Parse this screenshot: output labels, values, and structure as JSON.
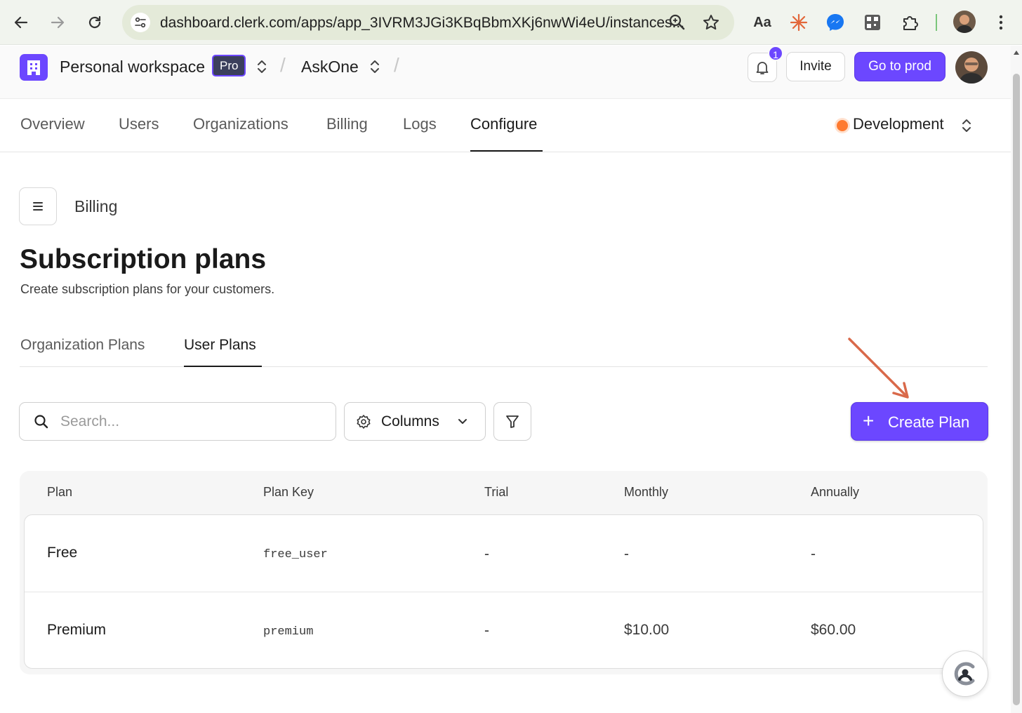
{
  "browser": {
    "url": "dashboard.clerk.com/apps/app_3IVRM3JGi3KBqBbmXKj6nwWi4eU/instances...",
    "ext_aa_label": "Aa"
  },
  "header": {
    "workspace_name": "Personal workspace",
    "plan_badge": "Pro",
    "separator": "/",
    "app_name": "AskOne",
    "notification_count": "1",
    "invite_label": "Invite",
    "go_prod_label": "Go to prod"
  },
  "nav": {
    "items": [
      {
        "label": "Overview"
      },
      {
        "label": "Users"
      },
      {
        "label": "Organizations"
      },
      {
        "label": "Billing"
      },
      {
        "label": "Logs"
      },
      {
        "label": "Configure"
      }
    ],
    "active": "Configure",
    "environment": "Development"
  },
  "main": {
    "section": "Billing",
    "title": "Subscription plans",
    "subtitle": "Create subscription plans for your customers.",
    "tabs": [
      {
        "label": "Organization Plans"
      },
      {
        "label": "User Plans"
      }
    ],
    "active_tab": "User Plans",
    "search_placeholder": "Search...",
    "columns_label": "Columns",
    "create_label": "Create Plan",
    "create_plus": "+"
  },
  "table": {
    "headers": [
      "Plan",
      "Plan Key",
      "Trial",
      "Monthly",
      "Annually"
    ],
    "rows": [
      {
        "plan": "Free",
        "key": "free_user",
        "trial": "-",
        "monthly": "-",
        "annually": "-"
      },
      {
        "plan": "Premium",
        "key": "premium",
        "trial": "-",
        "monthly": "$10.00",
        "annually": "$60.00"
      }
    ]
  },
  "colors": {
    "accent": "#6c47ff",
    "env_dot": "#ff7a2f",
    "annotation_arrow": "#d9694a"
  },
  "icons": [
    "back-arrow-icon",
    "forward-arrow-icon",
    "reload-icon",
    "site-settings-icon",
    "zoom-icon",
    "star-icon",
    "bell-icon",
    "menu-icon",
    "search-icon",
    "gear-icon",
    "chevron-down-icon",
    "filter-icon",
    "plus-icon",
    "clerk-logo-icon"
  ]
}
